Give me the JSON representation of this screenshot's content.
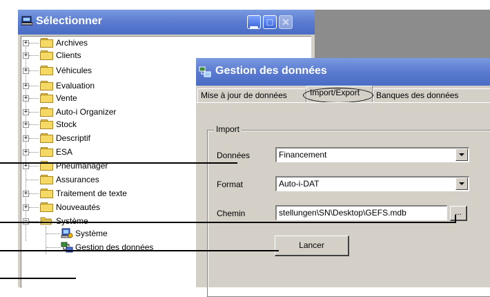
{
  "main_window": {
    "title": "Sélectionner",
    "icon": "computer-icon",
    "controls": [
      "minimize-icon",
      "maximize-icon",
      "close-icon"
    ]
  },
  "tree": {
    "items": [
      {
        "label": "Archives",
        "expandable": true
      },
      {
        "label": "Clients",
        "expandable": true
      },
      {
        "label": "Véhicules",
        "expandable": true
      },
      {
        "label": "Evaluation",
        "expandable": true
      },
      {
        "label": "Vente",
        "expandable": true
      },
      {
        "label": "Auto-i Organizer",
        "expandable": true
      },
      {
        "label": "Stock",
        "expandable": true
      },
      {
        "label": "Descriptif",
        "expandable": true
      },
      {
        "label": "ESA",
        "expandable": true
      },
      {
        "label": "Pneumanager",
        "expandable": true
      },
      {
        "label": "Assurances",
        "expandable": false
      },
      {
        "label": "Traitement de texte",
        "expandable": true
      },
      {
        "label": "Nouveautés",
        "expandable": true
      },
      {
        "label": "Système",
        "expandable": true,
        "expanded": true
      }
    ],
    "children": [
      {
        "label": "Système",
        "icon": "system-icon"
      },
      {
        "label": "Gestion des données",
        "icon": "data-management-icon"
      }
    ]
  },
  "dialog": {
    "title": "Gestion des données",
    "tabs": [
      {
        "label": "Mise à jour de données",
        "active": false
      },
      {
        "label": "Import/Export",
        "active": true
      },
      {
        "label": "Banques des données",
        "active": false
      }
    ],
    "group_label": "Import",
    "fields": {
      "donnees": {
        "label": "Données",
        "value": "Financement"
      },
      "format": {
        "label": "Format",
        "value": "Auto-i-DAT"
      },
      "chemin": {
        "label": "Chemin",
        "value": "stellungen\\SN\\Desktop\\GEFS.mdb"
      }
    },
    "browse_label": "...",
    "launch_label": "Lancer"
  }
}
